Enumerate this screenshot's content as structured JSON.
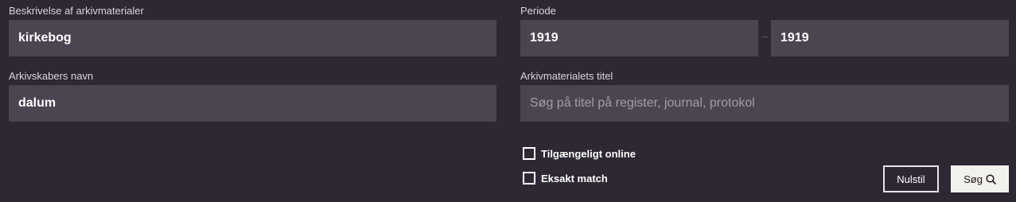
{
  "description": {
    "label": "Beskrivelse af arkivmaterialer",
    "value": "kirkebog"
  },
  "period": {
    "label": "Periode",
    "from_value": "1919",
    "to_value": "1919"
  },
  "creator": {
    "label": "Arkivskabers navn",
    "value": "dalum"
  },
  "title": {
    "label": "Arkivmaterialets titel",
    "value": "",
    "placeholder": "Søg på titel på register, journal, protokol"
  },
  "options": {
    "online_label": "Tilgængeligt online",
    "online_checked": false,
    "exact_label": "Eksakt match",
    "exact_checked": false
  },
  "buttons": {
    "reset_label": "Nulstil",
    "search_label": "Søg",
    "search_icon": "search-icon"
  },
  "colors": {
    "background": "#2d2833",
    "field": "#4b4451",
    "search_button": "#f3f1ec"
  }
}
